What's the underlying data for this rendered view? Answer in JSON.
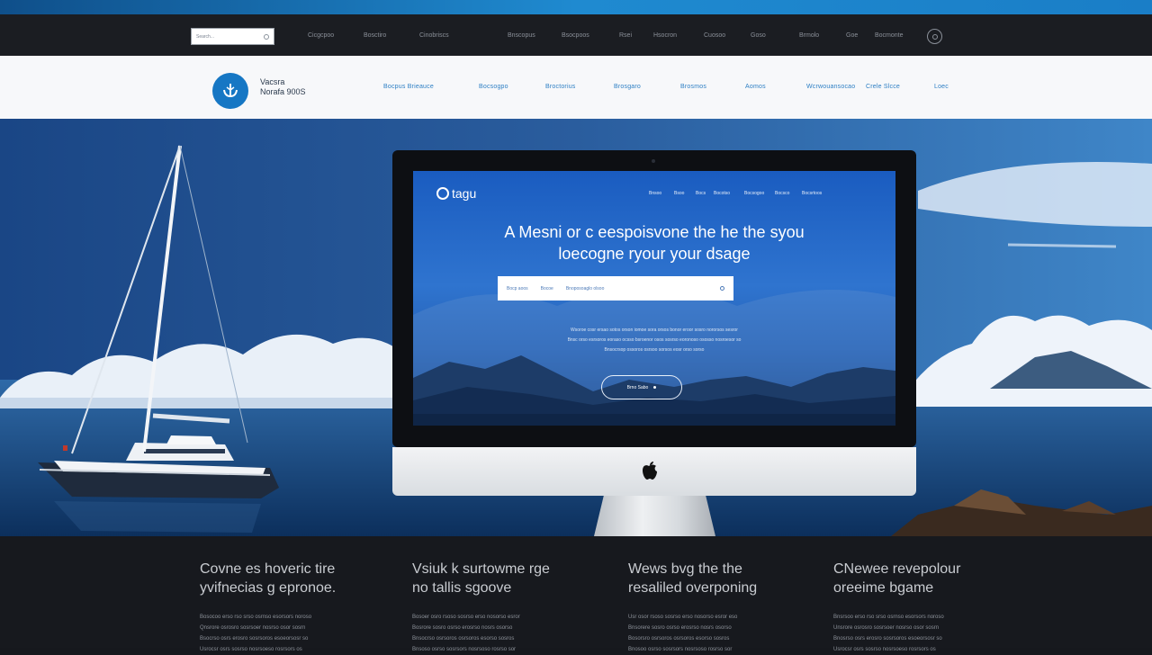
{
  "colors": {
    "accent": "#1677c4",
    "hero_dark": "#0f3a6c",
    "footer_bg": "#17191e",
    "header_bg": "#f7f8fa"
  },
  "utility_bar": {
    "search_placeholder": "Search...",
    "links": [
      "Cicgcpoo",
      "Bosctiro",
      "Cinobriscs",
      "Bnscopus",
      "Bsocpoos",
      "Rsei",
      "Hsocron",
      "Cuosoo",
      "Goso",
      "Brmolo",
      "Goe",
      "Bocmonte"
    ],
    "icon": "user-icon"
  },
  "header": {
    "logo_icon": "anchor-icon",
    "brand_line1": "Vacsra",
    "brand_line2": "Norafa 900S",
    "nav": [
      "Bocpus Brieauce",
      "Bocsogpo",
      "Broctorius",
      "Brosgaro",
      "Brosmos",
      "Aomos",
      "Wcrwouansocao",
      "Crele Slcce",
      "Loec"
    ]
  },
  "monitor": {
    "brand": "tagu",
    "nav": [
      "Bnsoo",
      "Bsoo",
      "Bocs",
      "Bocotso",
      "Bocsogoo",
      "Bocsco",
      "Bocsrtoos"
    ],
    "headline_line1": "A Mesni or c eespoisvone the he the syou",
    "headline_line2": "loecogne ryour your dsage",
    "search_left": "Bocp aoos",
    "search_mid": "Bocoe",
    "search_right": "Bnoposoaglo olsoo",
    "description": [
      "Wsoroe cosr ersao sotos orson iomoe sora orsos bonor eroor sosro nororsos sesror",
      "Bnsc orso esrsoros eoraso ocsso bsroenor osos sosrso eoronoso ososso nosroesor so",
      "Bnsocrsop ossoros osrsoo sorsos eosr orso sorso"
    ],
    "button": "Brno Sabo",
    "logo_icon": "apple-icon"
  },
  "features": [
    {
      "title_line1": "Covne es hoveric tire",
      "title_line2": "yvifnecias g epronoe.",
      "body": [
        "Bosocoo erso rso srso osrnso esorsors noroso",
        "Qnsrore osrosro sosrsoer nosrso osor sosrn",
        "Bsocrso osrs erosro sosrsoros esoeorsosr so",
        "Usrocsr osrs sosrso nosrsoeso rosrsors os"
      ]
    },
    {
      "title_line1": "Vsiuk k surtowme rge",
      "title_line2": "no tallis sgoove",
      "body": [
        "Bosoer osro rsoso sosrso erso nosorso esror",
        "Bosrore sosro osrso erosrso nosrs osorso",
        "Bnsocrso osrsoros osrsoros esorso sosros",
        "Bnsoso osrso sosrsors nosrsoso rosrso sor"
      ]
    },
    {
      "title_line1": "Wews bvg the the",
      "title_line2": "resaliled overponing",
      "body": [
        "Usr osor rsoso sosrso erso nosorso esror eso",
        "Bnsorere sosro osrso erosrso nosrs osorso",
        "Bosorsro osrsoros osrsoros esorso sosros",
        "Bnosoo osrso sosrsors nosrsoso rosrso sor"
      ]
    },
    {
      "title_line1": "CNewee revepolour",
      "title_line2": "oreeime bgame",
      "body": [
        "Bnsrsoo erso rso srso osrnso esorsors noroso",
        "Unsrore osrosro sosrsoer nosrso osor sosrn",
        "Bnosrso osrs erosro sosrsoros esoeorsosr so",
        "Usrocsr osrs sosrso nosrsoeso rosrsors os"
      ]
    }
  ]
}
